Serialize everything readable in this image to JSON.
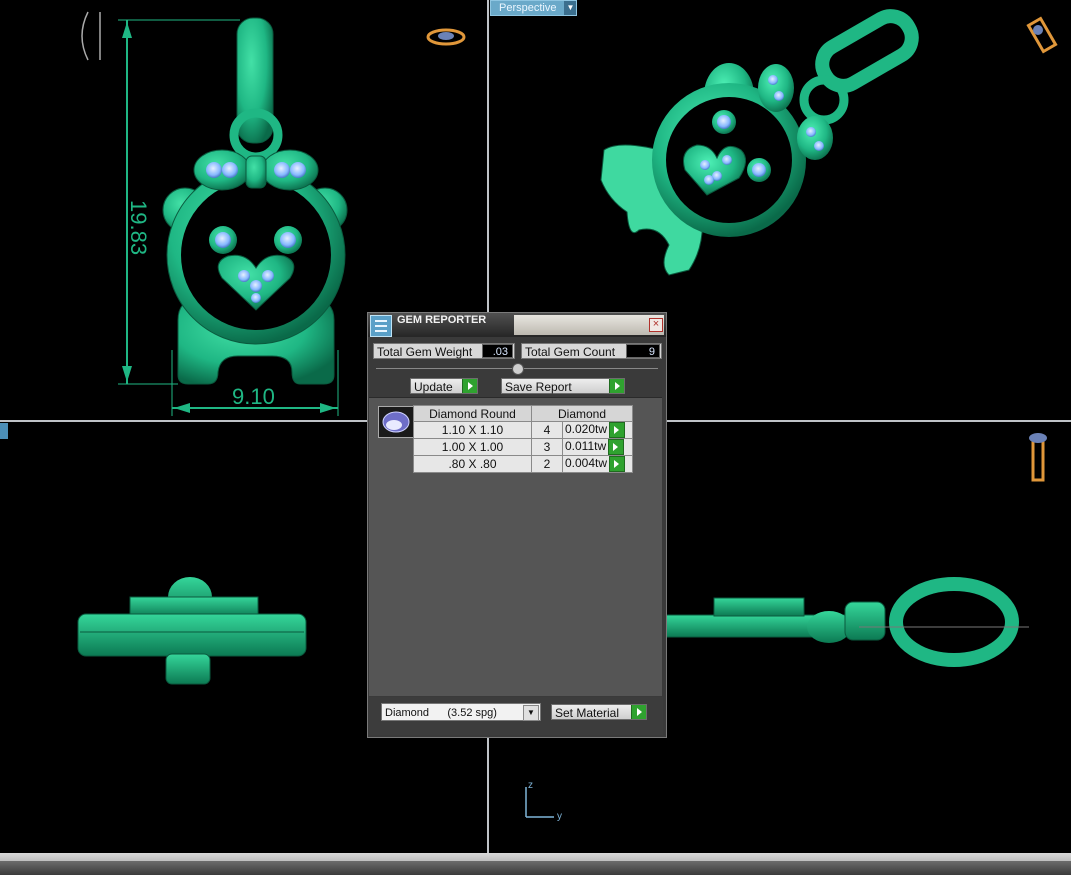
{
  "viewport": {
    "label": "Perspective",
    "dim_height": "19.83",
    "dim_width": "9.10",
    "axis_z": "z",
    "axis_y": "y"
  },
  "dialog": {
    "title": "GEM REPORTER",
    "total_weight_label": "Total Gem Weight",
    "total_weight_value": ".03",
    "total_count_label": "Total Gem Count",
    "total_count_value": "9",
    "update_label": "Update",
    "save_report_label": "Save Report",
    "table": {
      "col_shape": "Diamond Round",
      "col_material": "Diamond",
      "rows": [
        {
          "size": "1.10 X 1.10",
          "count": "4",
          "weight": "0.020tw"
        },
        {
          "size": "1.00 X 1.00",
          "count": "3",
          "weight": "0.011tw"
        },
        {
          "size": ".80 X .80",
          "count": "2",
          "weight": "0.004tw"
        }
      ]
    },
    "material_select": "Diamond      (3.52 spg)",
    "set_material_label": "Set Material"
  },
  "colors": {
    "metal": "#1fb784",
    "metal_dark": "#0f7d58",
    "gem": "#7fb5ff",
    "gem_light": "#cfe3ff"
  }
}
